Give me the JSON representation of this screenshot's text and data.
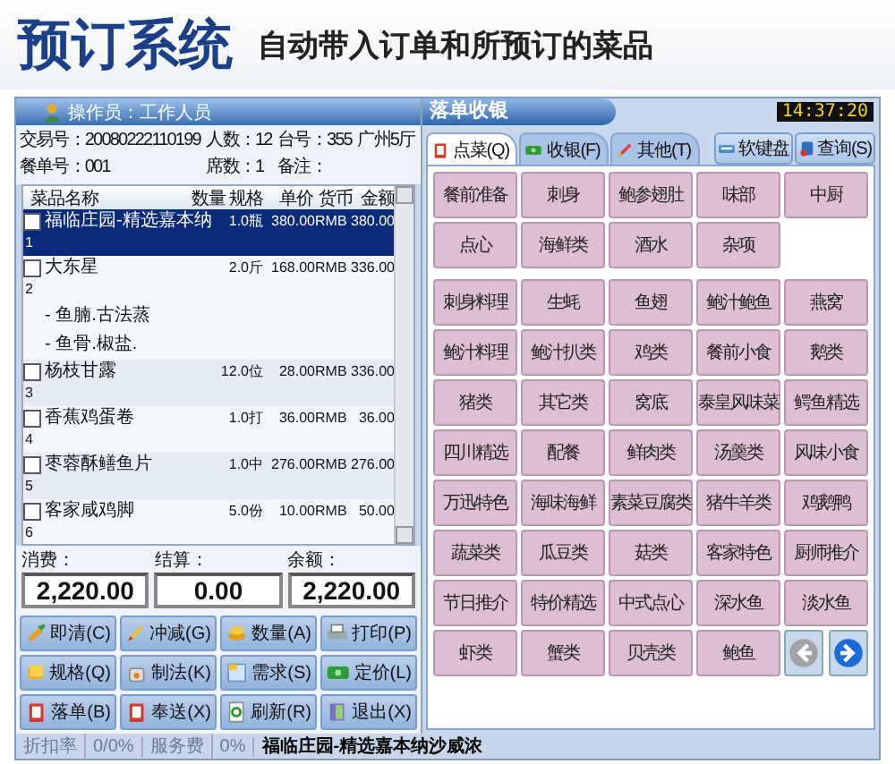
{
  "header": {
    "title": "预订系统",
    "subtitle": "自动带入订单和所预订的菜品"
  },
  "window": {
    "operator": "操作员：工作人员",
    "title": "落单收银",
    "clock": "14:37:20"
  },
  "order_info": [
    {
      "label": "交易号：",
      "value": "20080222110199"
    },
    {
      "label": "人数：",
      "value": "12"
    },
    {
      "label": "台号：",
      "value": "355"
    },
    {
      "value": "广州5厅"
    },
    {
      "label": "餐单号：",
      "value": "001"
    },
    {
      "label": "席数：",
      "value": "1"
    },
    {
      "label": "备注："
    }
  ],
  "table": {
    "columns": [
      "菜品名称",
      "数量",
      "规格",
      "单价",
      "货币",
      "金额"
    ],
    "rows": [
      {
        "name": "福临庄园-精选嘉本纳",
        "index": "1",
        "qty": "1.0",
        "unit": "瓶",
        "price": "380.00",
        "currency": "RMB",
        "amount": "380.00",
        "selected": true,
        "checked": false
      },
      {
        "name": "大东星",
        "index": "2",
        "qty": "2.0",
        "unit": "斤",
        "price": "168.00",
        "currency": "RMB",
        "amount": "336.00",
        "selected": false,
        "checked": false,
        "notes": [
          "- 鱼腩.古法蒸",
          "- 鱼骨.椒盐."
        ]
      },
      {
        "name": "杨枝甘露",
        "index": "3",
        "qty": "12.0",
        "unit": "位",
        "price": "28.00",
        "currency": "RMB",
        "amount": "336.00",
        "selected": false,
        "checked": false
      },
      {
        "name": "香蕉鸡蛋卷",
        "index": "4",
        "qty": "1.0",
        "unit": "打",
        "price": "36.00",
        "currency": "RMB",
        "amount": "36.00",
        "selected": false,
        "checked": false
      },
      {
        "name": "枣蓉酥鳝鱼片",
        "index": "5",
        "qty": "1.0",
        "unit": "中",
        "price": "276.00",
        "currency": "RMB",
        "amount": "276.00",
        "selected": false,
        "checked": false
      },
      {
        "name": "客家咸鸡脚",
        "index": "6",
        "qty": "5.0",
        "unit": "份",
        "price": "10.00",
        "currency": "RMB",
        "amount": "50.00",
        "selected": false,
        "checked": false
      }
    ]
  },
  "totals": [
    {
      "label": "消费：",
      "value": "2,220.00"
    },
    {
      "label": "结算：",
      "value": "0.00"
    },
    {
      "label": "余额：",
      "value": "2,220.00"
    }
  ],
  "actions": [
    "即清(C)",
    "冲减(G)",
    "数量(A)",
    "打印(P)",
    "规格(Q)",
    "制法(K)",
    "需求(S)",
    "定价(L)",
    "落单(B)",
    "奉送(X)",
    "刷新(R)",
    "退出(X)"
  ],
  "status_bar": {
    "discount_label": "折扣率",
    "discount": "0/0%",
    "service_label": "服务费",
    "service": "0%",
    "message": "福临庄园-精选嘉本纳沙威浓"
  },
  "tabs": [
    {
      "label": "点菜(Q)",
      "selected": true
    },
    {
      "label": "收银(F)",
      "selected": false
    },
    {
      "label": "其他(T)",
      "selected": false
    }
  ],
  "tools": [
    "软键盘",
    "查询(S)"
  ],
  "groups": [
    {
      "items": [
        "餐前准备",
        "刺身",
        "鲍参翅肚",
        "味部",
        "中厨",
        "点心",
        "海鲜类",
        "酒水",
        "杂项"
      ]
    },
    {
      "items": [
        "刺身料理",
        "生蚝",
        "鱼翅",
        "鲍汁鲍鱼",
        "燕窝",
        "鲍汁料理",
        "鲍汁扒类",
        "鸡类",
        "餐前小食",
        "鹅类",
        "猪类",
        "其它类",
        "窝底",
        "泰皇风味菜",
        "鳄鱼精选",
        "四川精选",
        "配餐",
        "鲜肉类",
        "汤羹类",
        "风味小食",
        "万迅特色",
        "海味海鲜",
        "素菜豆腐类",
        "猪牛羊类",
        "鸡鹅鸭",
        "蔬菜类",
        "瓜豆类",
        "菇类",
        "客家特色",
        "厨师推介",
        "节日推介",
        "特价精选",
        "中式点心",
        "深水鱼",
        "淡水鱼",
        "虾类",
        "蟹类",
        "贝壳类",
        "鲍鱼"
      ]
    }
  ],
  "pager": [
    {
      "kind": "prev",
      "disabled": true
    },
    {
      "kind": "next",
      "disabled": false
    }
  ]
}
